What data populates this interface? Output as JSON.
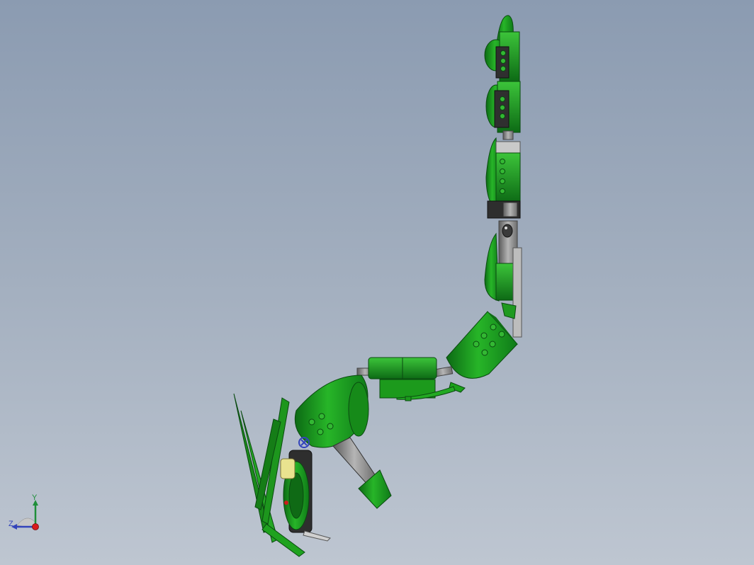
{
  "viewport": {
    "background_top": "#8b9bb1",
    "background_bottom": "#bec6d1"
  },
  "model": {
    "part_color": "#1fa31f",
    "part_dark": "#0b5e12",
    "connector_color": "#8c8c8c",
    "connector_dark": "#3a3a3a",
    "accent_yellow": "#e9e38f",
    "accent_red": "#cc1b1b"
  },
  "triad": {
    "y_label": "Y",
    "z_label": "Z",
    "y_color": "#1f8f3a",
    "z_color": "#3344bb",
    "origin_color": "#d81b1b"
  }
}
